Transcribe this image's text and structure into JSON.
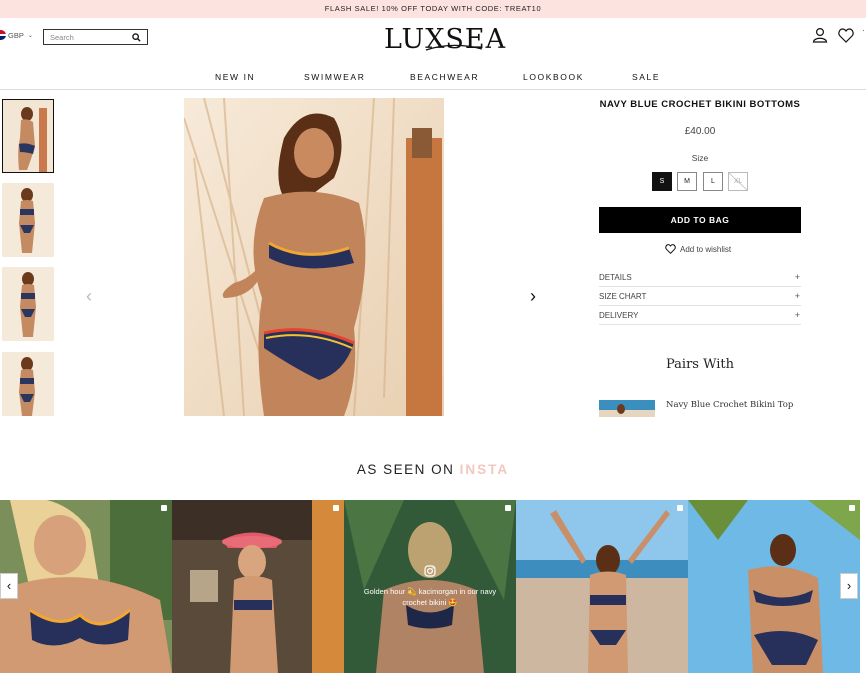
{
  "promo": {
    "text": "FLASH SALE! 10% OFF TODAY WITH CODE: TREAT10"
  },
  "header": {
    "currency": "GBP",
    "search_placeholder": "Search",
    "logo": "LUXSEA"
  },
  "nav": [
    {
      "label": "NEW IN"
    },
    {
      "label": "SWIMWEAR"
    },
    {
      "label": "BEACHWEAR"
    },
    {
      "label": "LOOKBOOK"
    },
    {
      "label": "SALE"
    }
  ],
  "product": {
    "title": "NAVY BLUE CROCHET BIKINI BOTTOMS",
    "price": "£40.00",
    "size_label": "Size",
    "sizes": [
      {
        "label": "S",
        "selected": true,
        "available": true
      },
      {
        "label": "M",
        "selected": false,
        "available": true
      },
      {
        "label": "L",
        "selected": false,
        "available": true
      },
      {
        "label": "XL",
        "selected": false,
        "available": false
      }
    ],
    "add_to_bag": "ADD TO BAG",
    "wishlist": "Add to wishlist",
    "accordion": [
      {
        "label": "DETAILS"
      },
      {
        "label": "SIZE CHART"
      },
      {
        "label": "DELIVERY"
      }
    ]
  },
  "pairs_with": {
    "title": "Pairs With",
    "items": [
      {
        "name": "Navy Blue Crochet Bikini Top"
      }
    ]
  },
  "insta": {
    "title_prefix": "AS SEEN ON",
    "title_accent": "INSTA",
    "caption": "Golden hour 💫 kacimorgan in our navy crochet bikini 🤩"
  },
  "colors": {
    "promo_bg": "#fde3e0",
    "accent_pink": "#f4c6c0",
    "button_black": "#000000"
  }
}
